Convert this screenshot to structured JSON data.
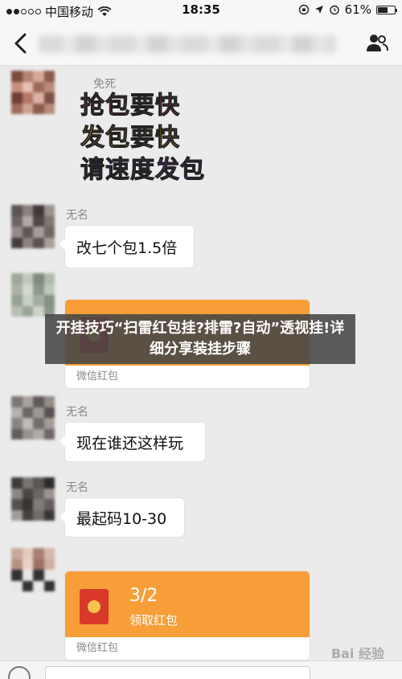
{
  "status_bar": {
    "carrier": "中国移动",
    "time": "18:35",
    "battery_percent": "61%",
    "battery_level": 0.61
  },
  "nav": {
    "back_icon": "chevron-left-icon",
    "members_icon": "people-icon"
  },
  "messages": [
    {
      "sender": "免死",
      "type": "sticker",
      "lines": [
        "抢包要快",
        "发包要快",
        "请速度发包"
      ],
      "colors": [
        "#e23a8c",
        "#f0a21c",
        "#7a3bd6"
      ]
    },
    {
      "sender": "无名",
      "type": "text",
      "text": "改七个包1.5倍"
    },
    {
      "sender": "",
      "type": "red_packet",
      "footer": "微信红包"
    },
    {
      "sender": "无名",
      "type": "text",
      "text": "现在谁还这样玩"
    },
    {
      "sender": "无名",
      "type": "text",
      "text": "最起码10-30"
    },
    {
      "sender": "",
      "type": "red_packet",
      "main": "3/2",
      "sub": "领取红包",
      "footer": "微信红包"
    }
  ],
  "headline": "开挂技巧“扫雷红包挂?排雷?自动”透视挂!详细分享装挂步骤",
  "watermark": "Bai 经验",
  "colors": {
    "red_packet_orange": "#f79e39",
    "red_packet_icon": "#d9372a",
    "background": "#ebebeb"
  }
}
